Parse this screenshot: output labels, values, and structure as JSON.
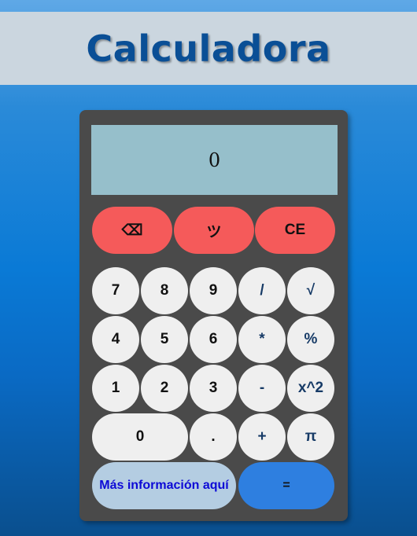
{
  "header": {
    "title": "Calculadora"
  },
  "display": {
    "value": "0"
  },
  "top_row": {
    "backspace": "⌫",
    "smiley": "ツ",
    "clear": "CE"
  },
  "keys": {
    "seven": "7",
    "eight": "8",
    "nine": "9",
    "divide": "/",
    "sqrt": "√",
    "four": "4",
    "five": "5",
    "six": "6",
    "multiply": "*",
    "percent": "%",
    "one": "1",
    "two": "2",
    "three": "3",
    "minus": "-",
    "power": "x^2",
    "zero": "0",
    "dot": ".",
    "plus": "+",
    "pi": "π"
  },
  "bottom": {
    "info_link": "Más información aquí",
    "equals": "="
  },
  "colors": {
    "header_bg": "#cbd6df",
    "title": "#0a4f96",
    "calculator_bg": "#4a4a4a",
    "display_bg": "#96bfcb",
    "red_button": "#f55a5a",
    "key": "#efefef",
    "info_bg": "#b4cde2",
    "equals_bg": "#2e7fe0"
  }
}
